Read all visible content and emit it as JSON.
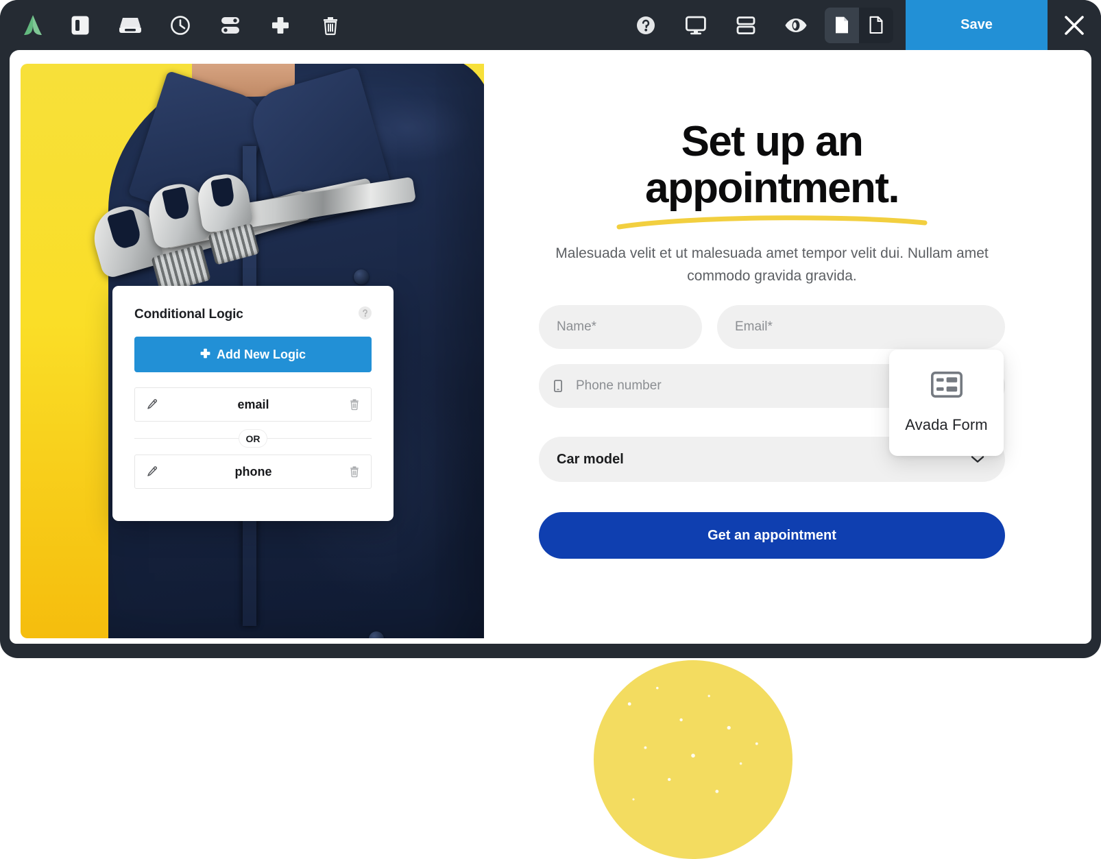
{
  "toolbar": {
    "left_icons": [
      {
        "name": "avada-logo-icon",
        "label": "Avada"
      },
      {
        "name": "sidebar-panel-icon",
        "label": "Toggle Sidebar"
      },
      {
        "name": "save-drawer-icon",
        "label": "Library"
      },
      {
        "name": "history-clock-icon",
        "label": "History"
      },
      {
        "name": "toggles-icon",
        "label": "Options"
      },
      {
        "name": "plus-icon",
        "label": "Add Element"
      },
      {
        "name": "trash-icon",
        "label": "Delete"
      }
    ],
    "right_icons": [
      {
        "name": "help-circle-icon",
        "label": "Help"
      },
      {
        "name": "monitor-icon",
        "label": "Responsive"
      },
      {
        "name": "rows-layout-icon",
        "label": "Layout"
      },
      {
        "name": "eye-icon",
        "label": "Preview"
      }
    ],
    "page_toggle": [
      {
        "name": "page-filled-icon",
        "label": "Page Builder",
        "active": true
      },
      {
        "name": "page-outline-icon",
        "label": "Default Editor",
        "active": false
      }
    ],
    "save_label": "Save",
    "close_label": "✕",
    "save_color": "#2290d6",
    "bar_color": "#252b33"
  },
  "conditional_logic": {
    "title": "Conditional Logic",
    "help_icon": "help-circle-icon",
    "add_button_label": "Add New Logic",
    "add_button_icon": "plus-icon",
    "add_button_color": "#2290d6",
    "divider_label": "OR",
    "rows": [
      {
        "label": "email",
        "edit_icon": "pencil-icon",
        "delete_icon": "trash-icon"
      },
      {
        "label": "phone",
        "edit_icon": "pencil-icon",
        "delete_icon": "trash-icon"
      }
    ]
  },
  "avada_card": {
    "label": "Avada Form",
    "icon": "form-layout-icon"
  },
  "page": {
    "heading": "Set up an\nappointment.",
    "heading_underline_color": "#f2cf3f",
    "subheading": "Malesuada velit et ut malesuada amet tempor velit dui. Nullam amet commodo gravida gravida.",
    "fields": [
      {
        "name": "name-field",
        "placeholder": "Name*",
        "icon": null
      },
      {
        "name": "email-field",
        "placeholder": "Email*",
        "icon": null
      },
      {
        "name": "phone-field",
        "placeholder": "Phone number",
        "icon": "mobile-phone-icon"
      }
    ],
    "select": {
      "name": "car-model-select",
      "value": "Car model",
      "icon": "chevron-down-icon"
    },
    "submit": {
      "label": "Get an appointment",
      "color": "#0f3fb0"
    },
    "hero": {
      "name": "hero-photo",
      "description": "Mechanic in navy coveralls holding wrenches on yellow background",
      "background_color": "#f7de2d"
    }
  },
  "decoration": {
    "circle_color": "#f3dc60"
  }
}
